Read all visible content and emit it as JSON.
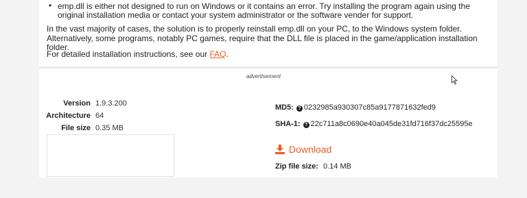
{
  "intro": {
    "bullet": "emp.dll is either not designed to run on Windows or it contains an error. Try installing the program again using the original installation media or contact your system administrator or the software vender for support.",
    "paragraph": "In the vast majority of cases, the solution is to properly reinstall emp.dll on your PC, to the Windows system folder. Alternatively, some programs, notably PC games, require that the DLL file is placed in the game/application installation folder.",
    "faq_prefix": "For detailed installation instructions, see our ",
    "faq_link": "FAQ",
    "faq_suffix": "."
  },
  "ad_label": "advertisement",
  "file_info": {
    "version_label": "Version",
    "version": "1.9.3.200",
    "architecture_label": "Architecture",
    "architecture": "64",
    "file_size_label": "File size",
    "file_size": "0.35 MB"
  },
  "hashes": {
    "md5_label": "MD5:",
    "md5": "0232985a930307c85a9177871632fed9",
    "sha1_label": "SHA-1:",
    "sha1": "22c711a8c0690e40a045de31fd716f37dc25595e"
  },
  "download": {
    "label": "Download",
    "zip_size_label": "Zip file size:",
    "zip_size": "0.14 MB"
  },
  "colors": {
    "accent": "#f15a24",
    "background": "#f4f4f4",
    "card": "#ffffff"
  },
  "icons": {
    "help": "question-circle-icon",
    "download": "download-icon",
    "cursor": "mouse-pointer-icon"
  }
}
